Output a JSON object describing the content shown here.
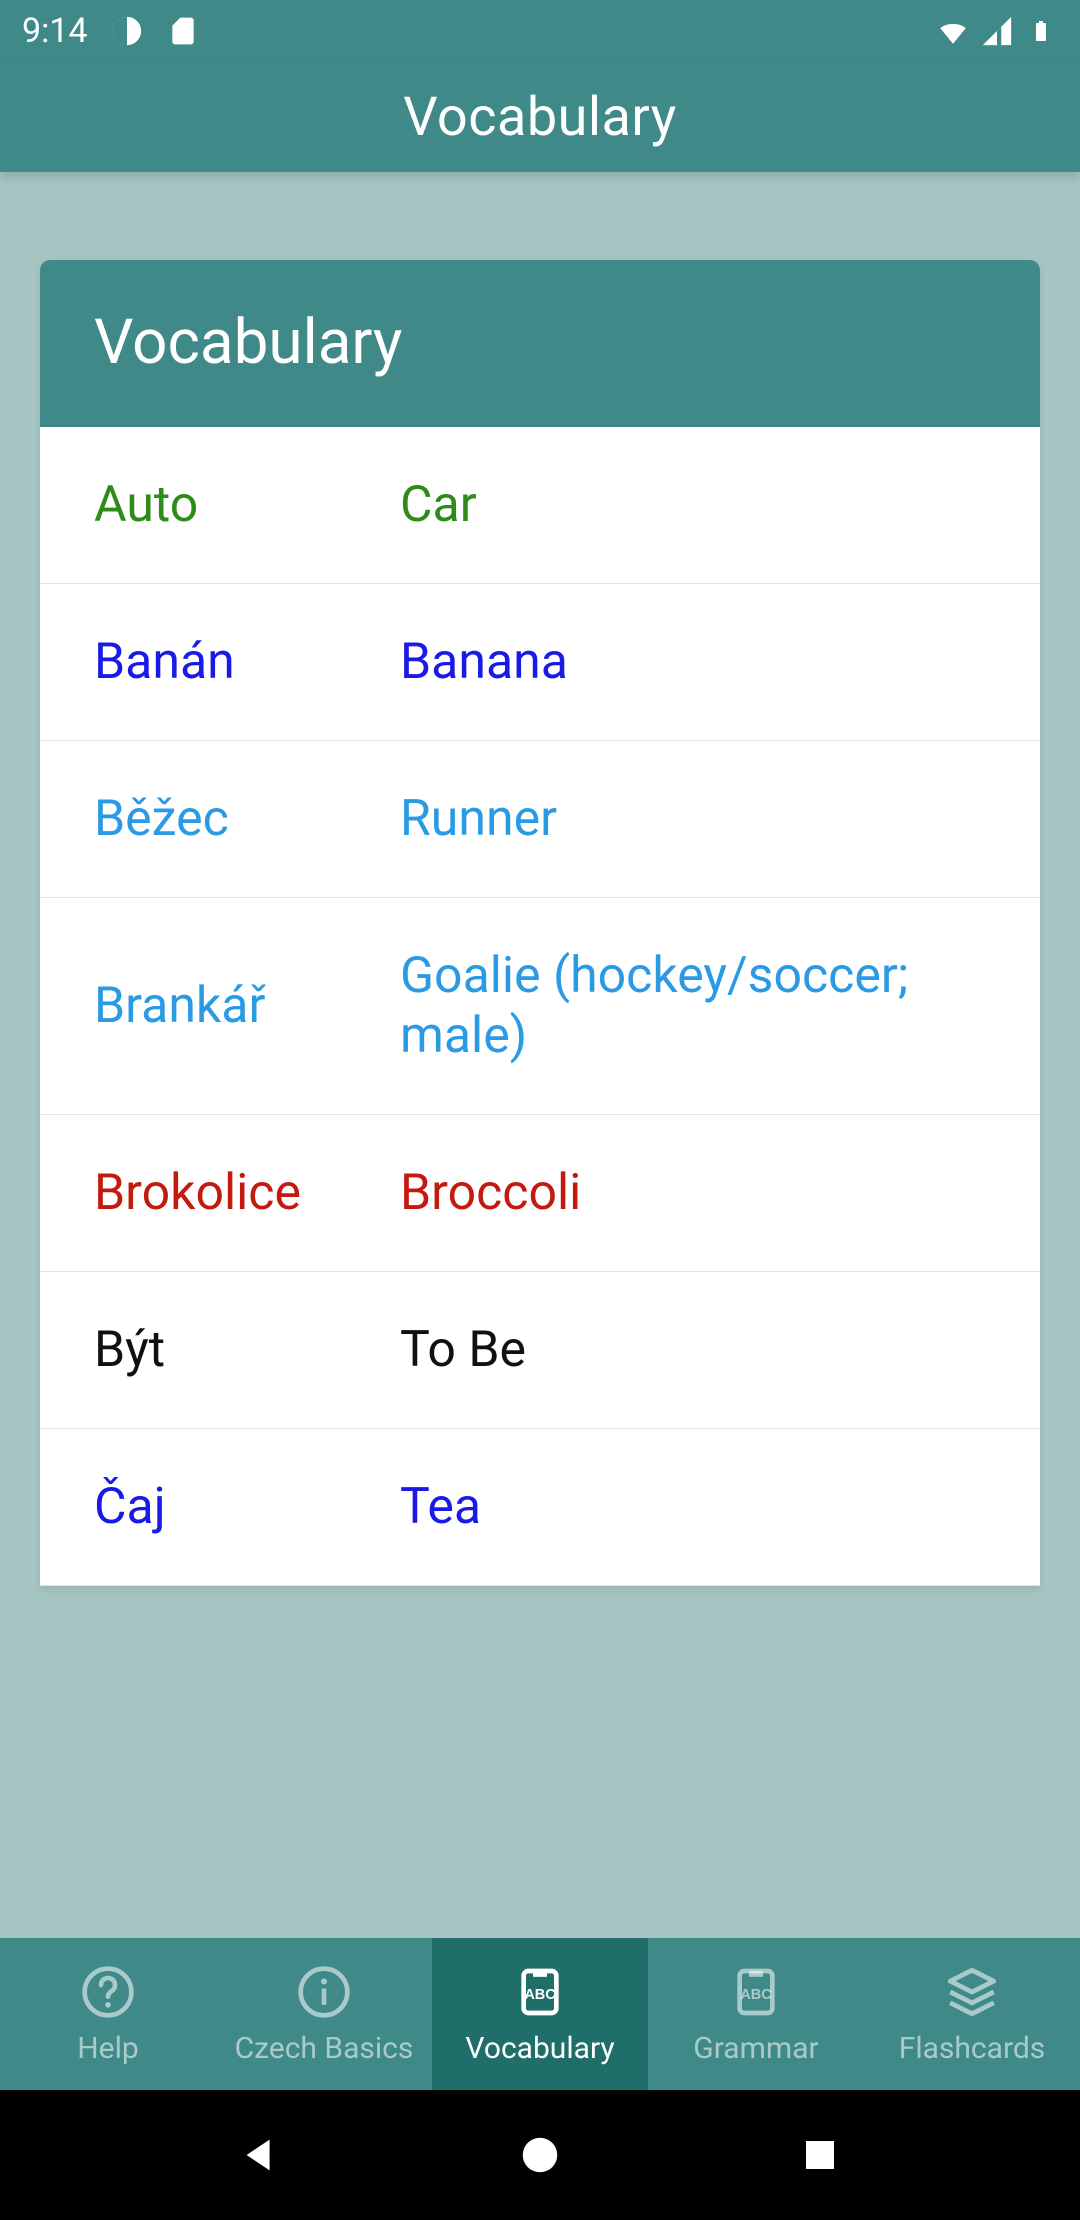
{
  "status": {
    "time": "9:14"
  },
  "appbar": {
    "title": "Vocabulary"
  },
  "card": {
    "header": "Vocabulary"
  },
  "rows": [
    {
      "src": "Auto",
      "trg": "Car",
      "color": "green"
    },
    {
      "src": "Banán",
      "trg": "Banana",
      "color": "blue"
    },
    {
      "src": "Běžec",
      "trg": "Runner",
      "color": "sky"
    },
    {
      "src": "Brankář",
      "trg": "Goalie (hockey/soccer; male)",
      "color": "sky"
    },
    {
      "src": "Brokolice",
      "trg": "Broccoli",
      "color": "red"
    },
    {
      "src": "Být",
      "trg": "To Be",
      "color": "black"
    },
    {
      "src": "Čaj",
      "trg": "Tea",
      "color": "blue"
    }
  ],
  "nav": {
    "items": [
      {
        "label": "Help",
        "icon": "help"
      },
      {
        "label": "Czech Basics",
        "icon": "info"
      },
      {
        "label": "Vocabulary",
        "icon": "book-abc"
      },
      {
        "label": "Grammar",
        "icon": "book-abc"
      },
      {
        "label": "Flashcards",
        "icon": "stack"
      }
    ],
    "activeIndex": 2
  }
}
